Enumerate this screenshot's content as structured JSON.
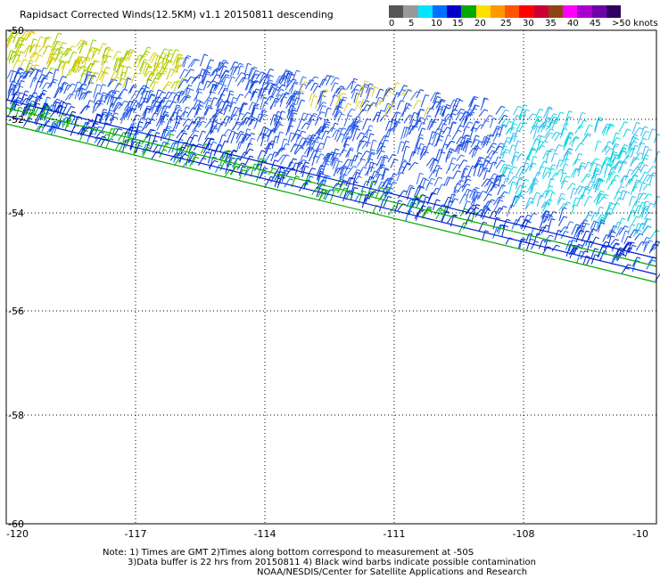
{
  "title": "Rapidsact Corrected Winds(12.5KM) v1.1 20150811 descending",
  "colorbar": {
    "colors": [
      "#555555",
      "#999999",
      "#00e5ff",
      "#0070ff",
      "#0000cc",
      "#00aa00",
      "#ffe000",
      "#ff9900",
      "#ff5500",
      "#ff0000",
      "#cc0033",
      "#8b4513",
      "#ff00ff",
      "#aa00cc",
      "#7000aa",
      "#300060"
    ],
    "labels": [
      "0",
      "5",
      "10",
      "15",
      "20",
      "25",
      "30",
      "35",
      "40",
      "45",
      ">50 knots"
    ]
  },
  "axes": {
    "x_ticks": [
      "-120",
      "-117",
      "-114",
      "-111",
      "-108",
      "-10"
    ],
    "y_ticks": [
      "-50",
      "-52",
      "-54",
      "-56",
      "-58",
      "-60"
    ],
    "x_range": [
      -120,
      -105
    ],
    "y_range": [
      -60,
      -50
    ]
  },
  "notes": [
    "Note: 1) Times are GMT 2)Times along bottom correspond to measurement at -50S",
    "3)Data buffer is 22 hrs from 20150811 4) Black wind barbs indicate possible contamination",
    "NOAA/NESDIS/Center for Satellite Applications and Research"
  ]
}
